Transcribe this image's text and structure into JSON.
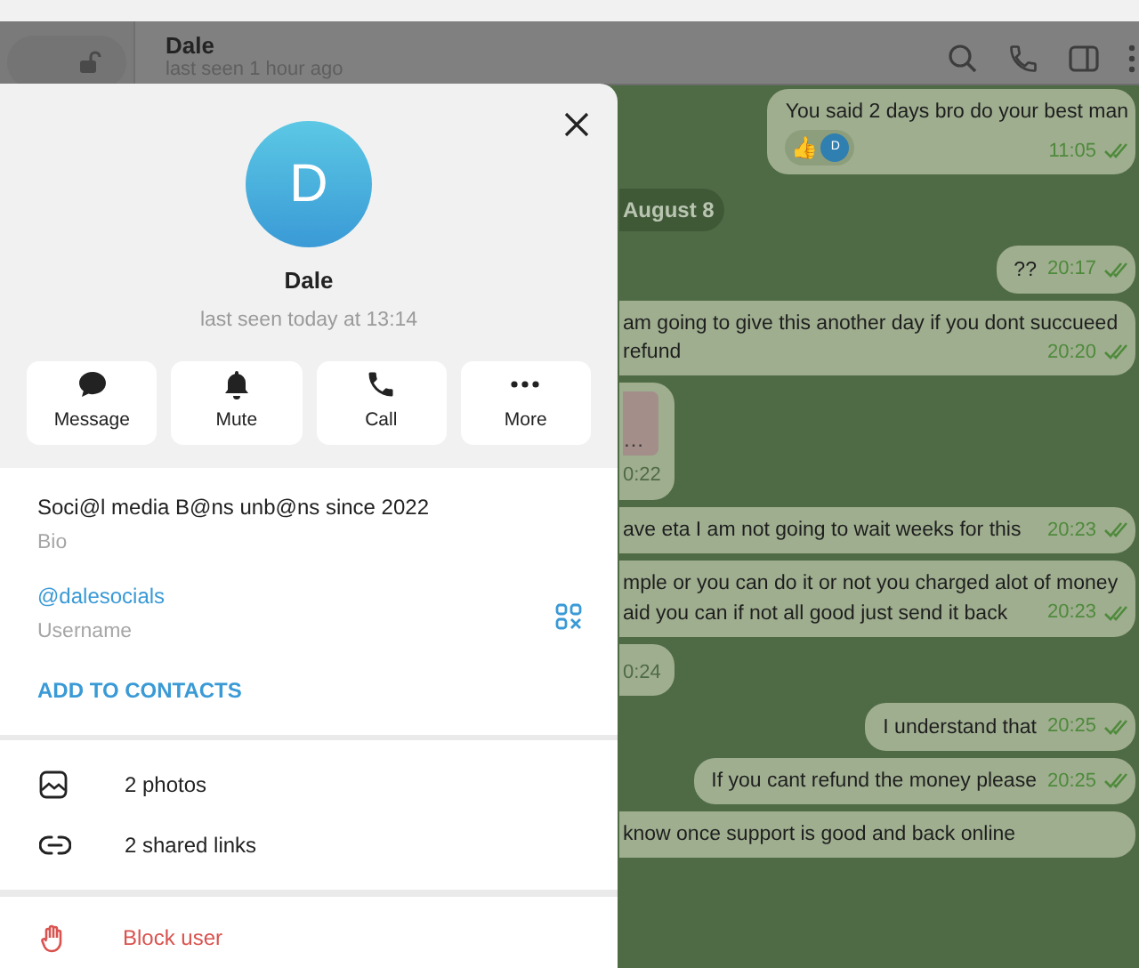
{
  "header": {
    "title": "Dale",
    "status": "last seen 1 hour ago"
  },
  "messages": [
    {
      "kind": "message",
      "lines": [
        "You said 2 days bro do your best man"
      ],
      "reactions": [
        {
          "kind": "emoji",
          "text": "👍"
        },
        {
          "kind": "avatar",
          "text": "D"
        }
      ],
      "time": "11:05"
    },
    {
      "kind": "date",
      "text": "August 8"
    },
    {
      "kind": "message",
      "lines": [
        "??"
      ],
      "time": "20:17"
    },
    {
      "kind": "clipped",
      "lines": [
        "am going to give this another day if you dont succueed",
        "refund"
      ],
      "time": "20:20"
    },
    {
      "kind": "media",
      "caption": "…",
      "time": "0:22"
    },
    {
      "kind": "clipped",
      "lines": [
        "ave eta I am not going to wait weeks for this"
      ],
      "time": "20:23"
    },
    {
      "kind": "clipped",
      "lines": [
        "mple or you can do it or not you charged alot of money",
        "aid you can if not all good just send it back"
      ],
      "time": "20:23"
    },
    {
      "kind": "stub",
      "time": "0:24"
    },
    {
      "kind": "message",
      "lines": [
        "I understand that"
      ],
      "time": "20:25"
    },
    {
      "kind": "message",
      "lines": [
        "If you cant refund the money please"
      ],
      "time": "20:25"
    },
    {
      "kind": "clipped",
      "lines": [
        "know once support is good and back online"
      ]
    }
  ],
  "profile": {
    "avatar_letter": "D",
    "name": "Dale",
    "status": "last seen today at 13:14",
    "actions": [
      {
        "label": "Message"
      },
      {
        "label": "Mute"
      },
      {
        "label": "Call"
      },
      {
        "label": "More"
      }
    ],
    "bio": {
      "value": "Soci@l media B@ns unb@ns since 2022",
      "label": "Bio"
    },
    "username": {
      "value": "@dalesocials",
      "label": "Username"
    },
    "add_contact": "ADD TO CONTACTS",
    "media": [
      {
        "label": "2 photos"
      },
      {
        "label": "2 shared links"
      }
    ],
    "block": "Block user"
  }
}
